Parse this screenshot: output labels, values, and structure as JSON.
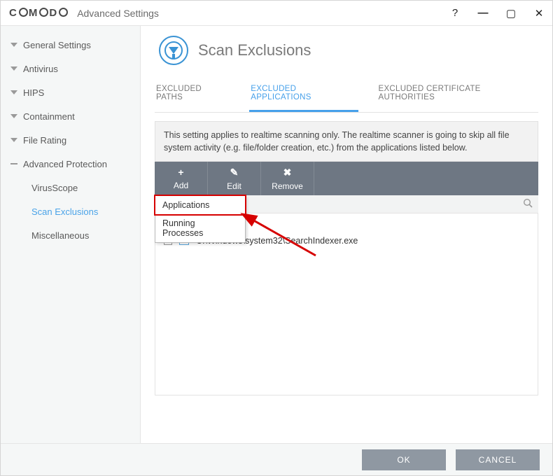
{
  "window": {
    "logo": "COMODO",
    "title": "Advanced Settings"
  },
  "sidebar": {
    "items": [
      {
        "label": "General Settings",
        "expanded": false
      },
      {
        "label": "Antivirus",
        "expanded": false
      },
      {
        "label": "HIPS",
        "expanded": false
      },
      {
        "label": "Containment",
        "expanded": false
      },
      {
        "label": "File Rating",
        "expanded": false
      },
      {
        "label": "Advanced Protection",
        "expanded": true,
        "children": [
          {
            "label": "VirusScope",
            "active": false
          },
          {
            "label": "Scan Exclusions",
            "active": true
          },
          {
            "label": "Miscellaneous",
            "active": false
          }
        ]
      }
    ]
  },
  "page": {
    "title": "Scan Exclusions",
    "tabs": [
      {
        "label": "EXCLUDED PATHS",
        "active": false
      },
      {
        "label": "EXCLUDED APPLICATIONS",
        "active": true
      },
      {
        "label": "EXCLUDED CERTIFICATE AUTHORITIES",
        "active": false
      }
    ],
    "info": "This setting applies to realtime scanning only. The realtime scanner is going to skip all file system activity (e.g. file/folder creation, etc.) from the applications listed below.",
    "toolbar": {
      "add": "Add",
      "edit": "Edit",
      "remove": "Remove",
      "dropdown": [
        {
          "label": "Applications"
        },
        {
          "label": "Running Processes"
        }
      ]
    },
    "rows": [
      {
        "path": "C:\\Windows\\system32\\SearchIndexer.exe"
      }
    ]
  },
  "footer": {
    "ok": "OK",
    "cancel": "CANCEL"
  }
}
